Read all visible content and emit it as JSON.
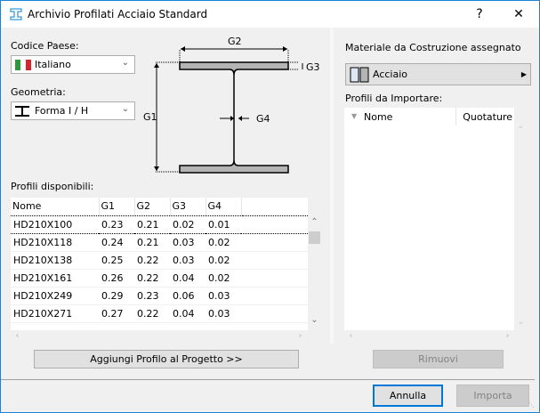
{
  "window": {
    "title": "Archivio Profilati Acciaio Standard",
    "help_label": "?",
    "close_label": "✕",
    "accent": "#1883d7"
  },
  "left": {
    "country_label": "Codice Paese:",
    "country_value": "Italiano",
    "geometry_label": "Geometria:",
    "geometry_value": "Forma I / H",
    "diagram": {
      "g1": "G1",
      "g2": "G2",
      "g3": "G3",
      "g4": "G4"
    },
    "profiles_label": "Profili disponibili:",
    "columns": [
      "Nome",
      "G1",
      "G2",
      "G3",
      "G4"
    ],
    "rows": [
      [
        "HD210X100",
        "0.23",
        "0.21",
        "0.02",
        "0.01"
      ],
      [
        "HD210X118",
        "0.24",
        "0.21",
        "0.03",
        "0.02"
      ],
      [
        "HD210X138",
        "0.25",
        "0.22",
        "0.03",
        "0.02"
      ],
      [
        "HD210X161",
        "0.26",
        "0.22",
        "0.04",
        "0.02"
      ],
      [
        "HD210X249",
        "0.29",
        "0.23",
        "0.06",
        "0.03"
      ],
      [
        "HD210X271",
        "0.27",
        "0.22",
        "0.04",
        "0.03"
      ]
    ],
    "add_button": "Aggiungi Profilo al Progetto >>"
  },
  "right": {
    "material_label": "Materiale da Costruzione assegnato",
    "material_value": "Acciaio",
    "import_label": "Profili da Importare:",
    "columns": [
      "Nome",
      "Quotature"
    ],
    "remove_button": "Rimuovi"
  },
  "footer": {
    "cancel": "Annulla",
    "import": "Importa"
  }
}
